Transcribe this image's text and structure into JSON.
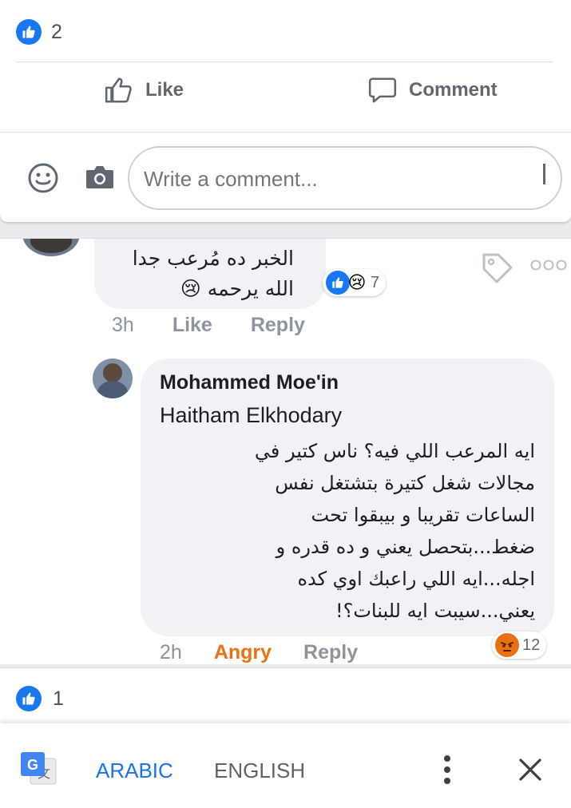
{
  "post": {
    "like_count": "2",
    "like_label": "Like",
    "comment_label": "Comment",
    "comment_placeholder": "Write a comment..."
  },
  "comments": [
    {
      "text_lines": [
        "الخبر ده مُرعب جدا",
        "الله يرحمه 😢"
      ],
      "reaction_count": "7",
      "time": "3h",
      "like_label": "Like",
      "reply_label": "Reply"
    },
    {
      "author": "Mohammed Moe'in",
      "mention": "Haitham Elkhodary",
      "text_lines": [
        "ايه المرعب اللي فيه؟ ناس كتير في",
        "مجالات شغل كتيرة بتشتغل نفس",
        "الساعات تقريبا و بيبقوا تحت",
        "ضغط...بتحصل يعني و ده قدره و",
        "اجله...ايه اللي راعبك اوي كده",
        "يعني...سيبت ايه للبنات؟!"
      ],
      "time": "2h",
      "reaction_label": "Angry",
      "reply_label": "Reply",
      "reaction_count": "12"
    }
  ],
  "bottom": {
    "like_count": "1"
  },
  "translate_bar": {
    "source_language": "ARABIC",
    "target_language": "ENGLISH"
  },
  "colors": {
    "facebook_blue": "#1877f2",
    "angry_orange": "#e9710f",
    "translate_blue": "#1a73e8"
  }
}
